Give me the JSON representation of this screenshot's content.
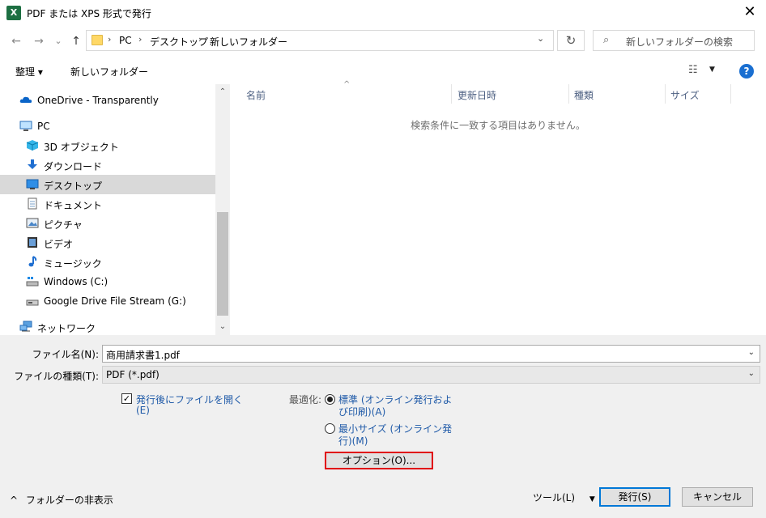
{
  "window": {
    "title": "PDF または XPS 形式で発行",
    "app_icon": "X",
    "close": "✕"
  },
  "nav": {
    "back": "←",
    "forward": "→",
    "recent": "⌄",
    "up": "↑",
    "breadcrumb": [
      "PC",
      "デスクトップ",
      "新しいフォルダー"
    ],
    "sep": "›",
    "dropdown": "⌄",
    "refresh": "↻",
    "search_placeholder": "新しいフォルダーの検索",
    "search_icon": "⌕"
  },
  "toolbar": {
    "organize": "整理 ▾",
    "new_folder": "新しいフォルダー",
    "view": "☷",
    "view_arrow": "▼",
    "help": "?"
  },
  "sidebar": {
    "items": [
      {
        "label": "OneDrive - Transparently",
        "icon": "cloud-icon"
      },
      {
        "label": "PC",
        "icon": "computer-icon"
      },
      {
        "label": "3D オブジェクト",
        "icon": "cube-icon"
      },
      {
        "label": "ダウンロード",
        "icon": "download-icon"
      },
      {
        "label": "デスクトップ",
        "icon": "desktop-icon",
        "selected": true
      },
      {
        "label": "ドキュメント",
        "icon": "document-icon"
      },
      {
        "label": "ピクチャ",
        "icon": "picture-icon"
      },
      {
        "label": "ビデオ",
        "icon": "video-icon"
      },
      {
        "label": "ミュージック",
        "icon": "music-icon"
      },
      {
        "label": "Windows (C:)",
        "icon": "drive-icon"
      },
      {
        "label": "Google Drive File Stream (G:)",
        "icon": "drive-icon"
      },
      {
        "label": "ネットワーク",
        "icon": "network-icon"
      }
    ],
    "scroll_up": "⌃",
    "scroll_down": "⌄"
  },
  "filelist": {
    "columns": [
      "名前",
      "更新日時",
      "種類",
      "サイズ"
    ],
    "sort_indicator": "^",
    "empty_message": "検索条件に一致する項目はありません。"
  },
  "form": {
    "filename_label": "ファイル名(N):",
    "filename_value": "商用請求書1.pdf",
    "filetype_label": "ファイルの種類(T):",
    "filetype_value": "PDF (*.pdf)",
    "dd": "⌄",
    "open_after_line1": "発行後にファイルを開く",
    "open_after_line2": "(E)",
    "open_after_checked": "✓",
    "optimize_label": "最適化:",
    "standard_line1": "標準 (オンライン発行およ",
    "standard_line2": "び印刷)(A)",
    "minimum_line1": "最小サイズ (オンライン発",
    "minimum_line2": "行)(M)",
    "options_button": "オプション(O)..."
  },
  "footer": {
    "hide_folders": "フォルダーの非表示",
    "hide_icon": "^",
    "tools": "ツール(L)",
    "tools_arrow": "▼",
    "publish": "発行(S)",
    "cancel": "キャンセル"
  },
  "colors": {
    "accent": "#0078d7",
    "highlight": "#e0000f",
    "link": "#1f5aa8"
  }
}
